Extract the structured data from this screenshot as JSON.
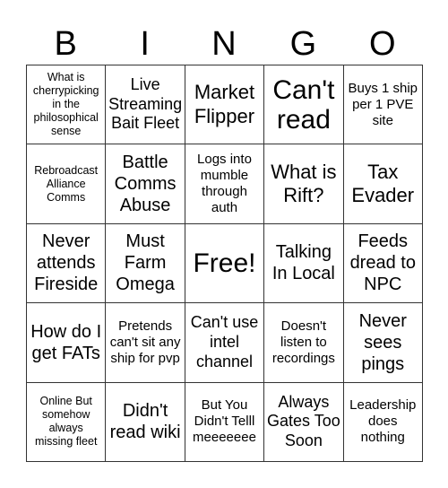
{
  "title_letters": [
    "B",
    "I",
    "N",
    "G",
    "O"
  ],
  "cells": [
    [
      "What is cherrypicking in the philosophical sense",
      "Live Streaming Bait Fleet",
      "Market Flipper",
      "Can't read",
      "Buys 1 ship per 1 PVE site"
    ],
    [
      "Rebroadcast Alliance Comms",
      "Battle Comms Abuse",
      "Logs into mumble through auth",
      "What is Rift?",
      "Tax Evader"
    ],
    [
      "Never attends Fireside",
      "Must Farm Omega",
      "Free!",
      "Talking In Local",
      "Feeds dread to NPC"
    ],
    [
      "How do I get FATs",
      "Pretends can't sit any ship for pvp",
      "Can't use intel channel",
      "Doesn't listen to recordings",
      "Never sees pings"
    ],
    [
      "Online But somehow always missing fleet",
      "Didn't read wiki",
      "But You Didn't Telll meeeeeee",
      "Always Gates Too Soon",
      "Leadership does nothing"
    ]
  ]
}
